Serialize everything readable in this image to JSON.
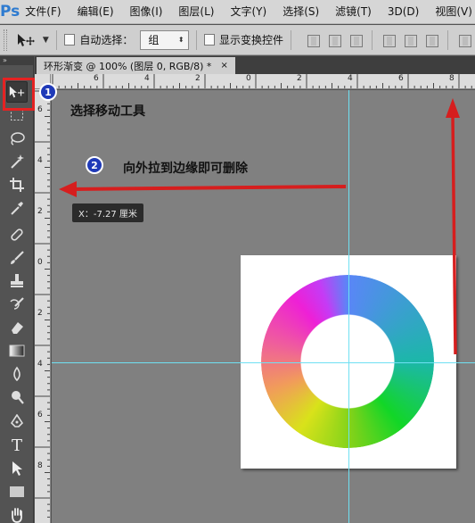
{
  "app": {
    "logo": "Ps"
  },
  "menu": [
    "文件(F)",
    "编辑(E)",
    "图像(I)",
    "图层(L)",
    "文字(Y)",
    "选择(S)",
    "滤镜(T)",
    "3D(D)",
    "视图(V)"
  ],
  "options": {
    "tool_icon": "move-tool-icon",
    "auto_select_label": "自动选择：",
    "auto_select_value": "组",
    "show_transform_label": "显示变换控件"
  },
  "tabs": [
    {
      "title": "环形渐变 @ 100% (图层 0, RGB/8) *",
      "close": "×"
    }
  ],
  "ruler_top": [
    "6",
    "4",
    "2",
    "0",
    "2",
    "4",
    "6",
    "8"
  ],
  "ruler_left": [
    "6",
    "4",
    "2",
    "0",
    "2",
    "4",
    "6",
    "8"
  ],
  "annotations": {
    "step1_badge": "1",
    "step1_text": "选择移动工具",
    "step2_badge": "2",
    "step2_text": "向外拉到边缘即可删除",
    "coordinate_tip": "X：-7.27 厘米"
  },
  "colors": {
    "highlight": "#e52222",
    "guide": "#6fe0f2",
    "badge": "#1f3ab8",
    "arrow": "#d61e1e"
  },
  "tools": [
    "move-tool-icon",
    "marquee-tool-icon",
    "lasso-tool-icon",
    "magic-wand-tool-icon",
    "crop-tool-icon",
    "eyedropper-tool-icon",
    "healing-brush-tool-icon",
    "brush-tool-icon",
    "clone-stamp-tool-icon",
    "history-brush-tool-icon",
    "eraser-tool-icon",
    "gradient-tool-icon",
    "blur-tool-icon",
    "dodge-tool-icon",
    "pen-tool-icon",
    "type-tool-icon",
    "path-selection-tool-icon",
    "rectangle-tool-icon",
    "hand-tool-icon"
  ]
}
